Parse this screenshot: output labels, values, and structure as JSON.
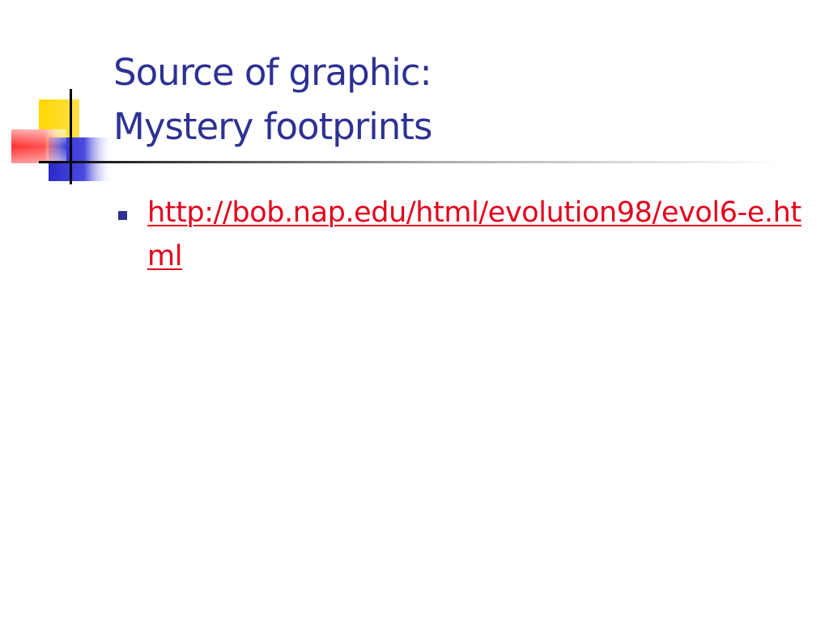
{
  "slide": {
    "title_lines": [
      "Source of graphic:",
      "Mystery footprints"
    ],
    "bullets": [
      {
        "text": "http://bob.nap.edu/html/evolution98/evol6-e.html",
        "is_link": true
      }
    ]
  },
  "colors": {
    "title": "#2e3192",
    "bullet_marker": "#2e3192",
    "link": "#e3001b",
    "deco_yellow": "#ffd700",
    "deco_blue": "#3434d0",
    "deco_red": "#ff3a3a",
    "deco_line": "#000000"
  },
  "icons": {
    "bullet": "square-bullet-icon",
    "decoration": "color-squares-decoration"
  }
}
